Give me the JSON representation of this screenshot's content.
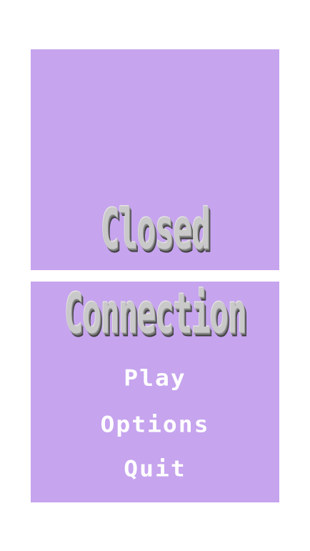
{
  "game": {
    "title_line_1": "Closed",
    "title_line_2": "Connection"
  },
  "menu": {
    "items": [
      {
        "label": "Play"
      },
      {
        "label": "Options"
      },
      {
        "label": "Quit"
      }
    ]
  },
  "colors": {
    "background": "#ffffff",
    "panel": "#c6a4ee",
    "menu_text": "#ffffff",
    "title_text": "#c9c9c9"
  }
}
